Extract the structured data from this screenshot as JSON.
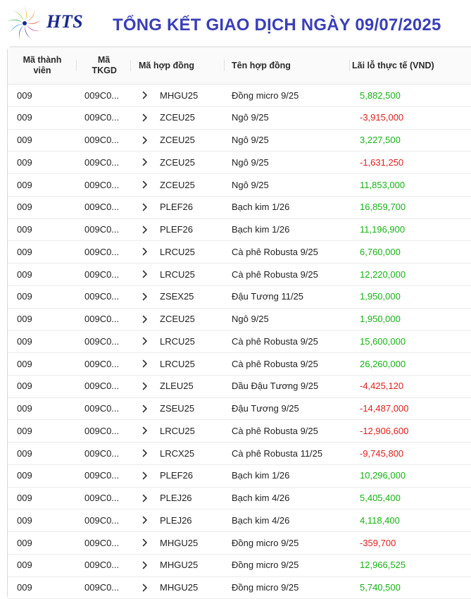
{
  "header": {
    "brand": "HTS",
    "title": "TỔNG KẾT GIAO DỊCH NGÀY 09/07/2025"
  },
  "colors": {
    "title": "#3a3fb8",
    "brand": "#1b2a8f",
    "profit": "#16b316",
    "loss": "#e0201d"
  },
  "table": {
    "columns": {
      "member": "Mã thành viên",
      "account": "Mã TKGD",
      "contract_code": "Mã hợp đồng",
      "contract_name": "Tên hợp đồng",
      "pnl": "Lãi lỗ thực tế (VND)"
    },
    "rows": [
      {
        "member": "009",
        "account": "009C0...",
        "code": "MHGU25",
        "name": "Đồng micro 9/25",
        "pnl": "5,882,500",
        "sign": "pos"
      },
      {
        "member": "009",
        "account": "009C0...",
        "code": "ZCEU25",
        "name": "Ngô 9/25",
        "pnl": "-3,915,000",
        "sign": "neg"
      },
      {
        "member": "009",
        "account": "009C0...",
        "code": "ZCEU25",
        "name": "Ngô 9/25",
        "pnl": "3,227,500",
        "sign": "pos"
      },
      {
        "member": "009",
        "account": "009C0...",
        "code": "ZCEU25",
        "name": "Ngô 9/25",
        "pnl": "-1,631,250",
        "sign": "neg"
      },
      {
        "member": "009",
        "account": "009C0...",
        "code": "ZCEU25",
        "name": "Ngô 9/25",
        "pnl": "11,853,000",
        "sign": "pos"
      },
      {
        "member": "009",
        "account": "009C0...",
        "code": "PLEF26",
        "name": "Bạch kim 1/26",
        "pnl": "16,859,700",
        "sign": "pos"
      },
      {
        "member": "009",
        "account": "009C0...",
        "code": "PLEF26",
        "name": "Bạch kim 1/26",
        "pnl": "11,196,900",
        "sign": "pos"
      },
      {
        "member": "009",
        "account": "009C0...",
        "code": "LRCU25",
        "name": "Cà phê Robusta 9/25",
        "pnl": "6,760,000",
        "sign": "pos"
      },
      {
        "member": "009",
        "account": "009C0...",
        "code": "LRCU25",
        "name": "Cà phê Robusta 9/25",
        "pnl": "12,220,000",
        "sign": "pos"
      },
      {
        "member": "009",
        "account": "009C0...",
        "code": "ZSEX25",
        "name": "Đậu Tương 11/25",
        "pnl": "1,950,000",
        "sign": "pos"
      },
      {
        "member": "009",
        "account": "009C0...",
        "code": "ZCEU25",
        "name": "Ngô 9/25",
        "pnl": "1,950,000",
        "sign": "pos"
      },
      {
        "member": "009",
        "account": "009C0...",
        "code": "LRCU25",
        "name": "Cà phê Robusta 9/25",
        "pnl": "15,600,000",
        "sign": "pos"
      },
      {
        "member": "009",
        "account": "009C0...",
        "code": "LRCU25",
        "name": "Cà phê Robusta 9/25",
        "pnl": "26,260,000",
        "sign": "pos"
      },
      {
        "member": "009",
        "account": "009C0...",
        "code": "ZLEU25",
        "name": "Dầu Đậu Tương 9/25",
        "pnl": "-4,425,120",
        "sign": "neg"
      },
      {
        "member": "009",
        "account": "009C0...",
        "code": "ZSEU25",
        "name": "Đậu Tương 9/25",
        "pnl": "-14,487,000",
        "sign": "neg"
      },
      {
        "member": "009",
        "account": "009C0...",
        "code": "LRCU25",
        "name": "Cà phê Robusta 9/25",
        "pnl": "-12,906,600",
        "sign": "neg"
      },
      {
        "member": "009",
        "account": "009C0...",
        "code": "LRCX25",
        "name": "Cà phê Robusta 11/25",
        "pnl": "-9,745,800",
        "sign": "neg"
      },
      {
        "member": "009",
        "account": "009C0...",
        "code": "PLEF26",
        "name": "Bạch kim 1/26",
        "pnl": "10,296,000",
        "sign": "pos"
      },
      {
        "member": "009",
        "account": "009C0...",
        "code": "PLEJ26",
        "name": "Bạch kim 4/26",
        "pnl": "5,405,400",
        "sign": "pos"
      },
      {
        "member": "009",
        "account": "009C0...",
        "code": "PLEJ26",
        "name": "Bạch kim 4/26",
        "pnl": "4,118,400",
        "sign": "pos"
      },
      {
        "member": "009",
        "account": "009C0...",
        "code": "MHGU25",
        "name": "Đồng micro 9/25",
        "pnl": "-359,700",
        "sign": "neg"
      },
      {
        "member": "009",
        "account": "009C0...",
        "code": "MHGU25",
        "name": "Đồng micro 9/25",
        "pnl": "12,966,525",
        "sign": "pos"
      },
      {
        "member": "009",
        "account": "009C0...",
        "code": "MHGU25",
        "name": "Đồng micro 9/25",
        "pnl": "5,740,500",
        "sign": "pos"
      }
    ]
  }
}
